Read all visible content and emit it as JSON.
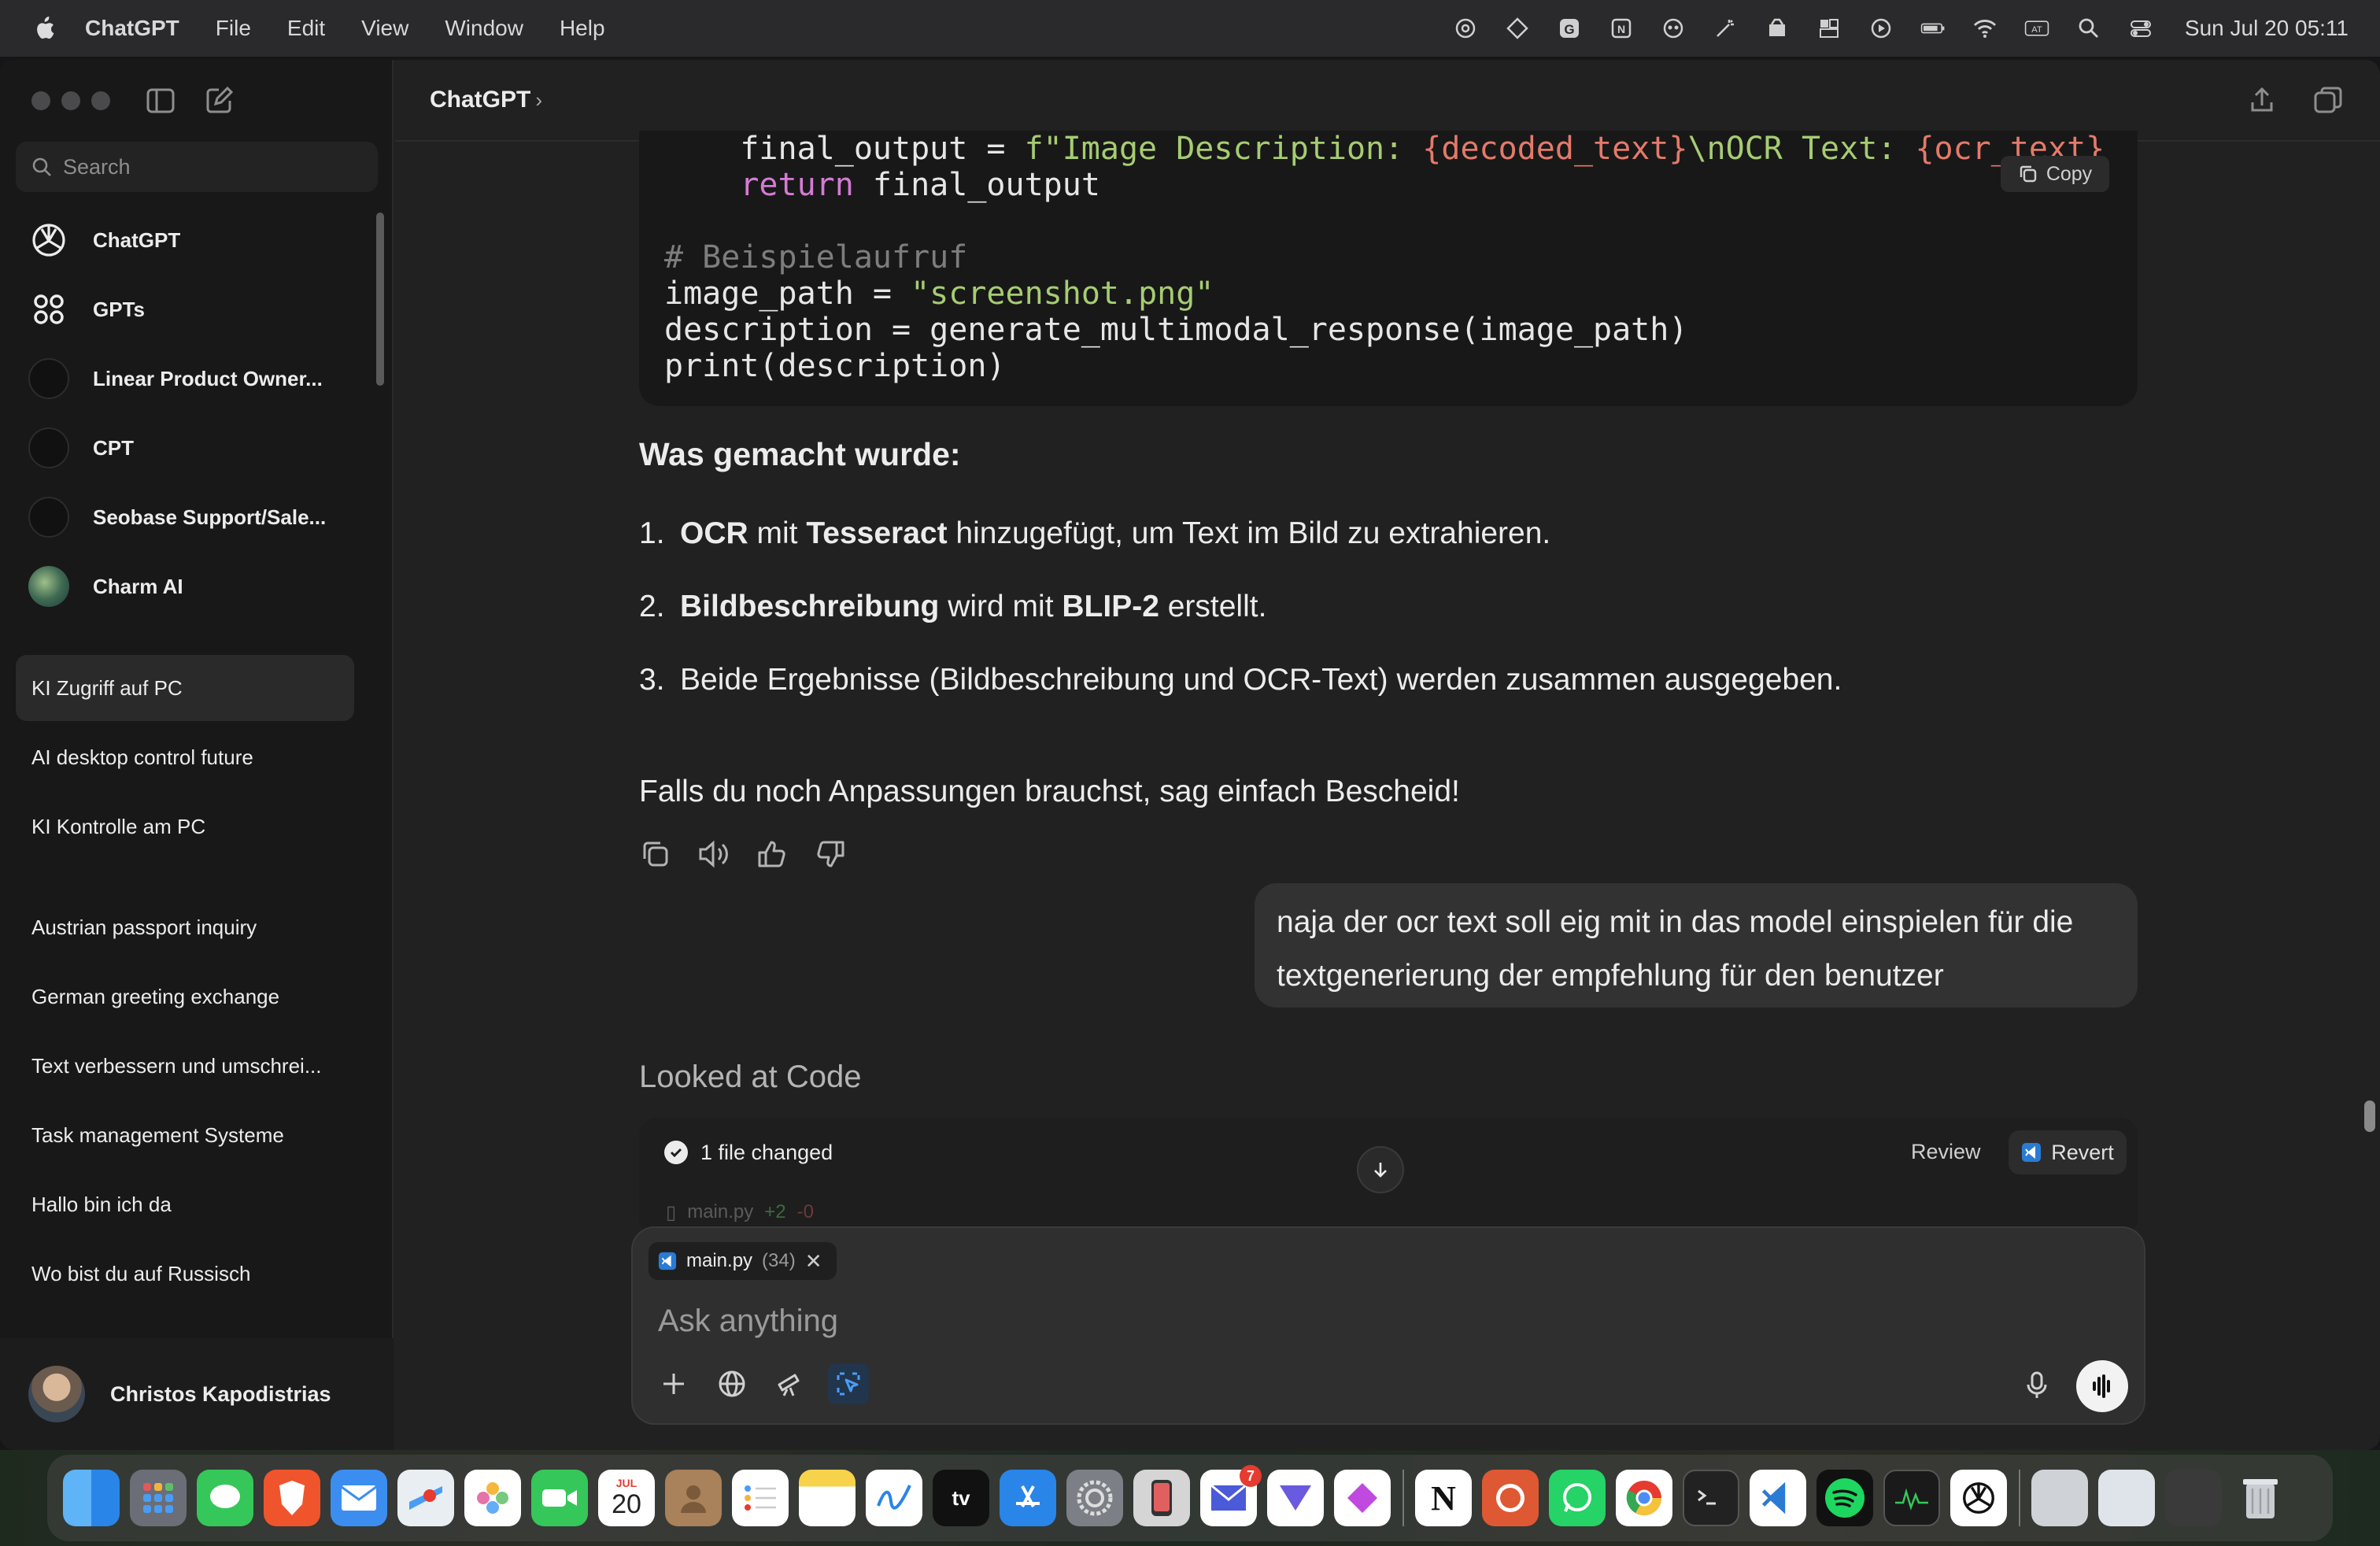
{
  "menubar": {
    "app": "ChatGPT",
    "menus": [
      "File",
      "Edit",
      "View",
      "Window",
      "Help"
    ],
    "clock": "Sun Jul 20  05:11"
  },
  "sidebar": {
    "search_placeholder": "Search",
    "nav": [
      {
        "label": "ChatGPT",
        "icon": "chatgpt-logo-icon"
      },
      {
        "label": "GPTs",
        "icon": "grid-dots-icon"
      },
      {
        "label": "Linear Product Owner...",
        "icon": "gpt-avatar"
      },
      {
        "label": "CPT",
        "icon": "gpt-avatar"
      },
      {
        "label": "Seobase Support/Sale...",
        "icon": "gpt-avatar"
      },
      {
        "label": "Charm AI",
        "icon": "gpt-avatar-image"
      }
    ],
    "chats": [
      "KI Zugriff auf PC",
      "AI desktop control future",
      "KI Kontrolle am PC",
      "Austrian passport inquiry",
      "German greeting exchange",
      "Text verbessern und umschrei...",
      "Task management Systeme",
      "Hallo bin ich da",
      "Wo bist du auf Russisch"
    ],
    "user": "Christos Kapodistrias"
  },
  "header": {
    "title": "ChatGPT",
    "chevron": "›"
  },
  "code": {
    "lines": [
      [
        {
          "t": "    final_output = ",
          "c": "pl"
        },
        {
          "t": "f\"Image Description: ",
          "c": "str"
        },
        {
          "t": "{decoded_text}",
          "c": "var"
        },
        {
          "t": "\\nOCR Text: ",
          "c": "str"
        },
        {
          "t": "{ocr_text}",
          "c": "var"
        }
      ],
      [
        {
          "t": "    ",
          "c": "pl"
        },
        {
          "t": "return",
          "c": "kw"
        },
        {
          "t": " final_output",
          "c": "pl"
        }
      ],
      [
        {
          "t": "",
          "c": "pl"
        }
      ],
      [
        {
          "t": "# Beispielaufruf",
          "c": "cm"
        }
      ],
      [
        {
          "t": "image_path = ",
          "c": "pl"
        },
        {
          "t": "\"screenshot.png\"",
          "c": "str"
        }
      ],
      [
        {
          "t": "description = generate_multimodal_response(image_path)",
          "c": "pl"
        }
      ],
      [
        {
          "t": "print(description)",
          "c": "pl"
        }
      ]
    ],
    "copy_label": "Copy"
  },
  "answer": {
    "heading": "Was gemacht wurde:",
    "items": [
      {
        "num": "1.",
        "parts": [
          {
            "t": "OCR",
            "b": true
          },
          {
            "t": " mit ",
            "b": false
          },
          {
            "t": "Tesseract",
            "b": true
          },
          {
            "t": " hinzugefügt, um Text im Bild zu extrahieren.",
            "b": false
          }
        ]
      },
      {
        "num": "2.",
        "parts": [
          {
            "t": "Bildbeschreibung",
            "b": true
          },
          {
            "t": " wird mit ",
            "b": false
          },
          {
            "t": "BLIP-2",
            "b": true
          },
          {
            "t": " erstellt.",
            "b": false
          }
        ]
      },
      {
        "num": "3.",
        "parts": [
          {
            "t": "Beide Ergebnisse (Bildbeschreibung und OCR-Text) werden zusammen ausgegeben.",
            "b": false
          }
        ]
      }
    ],
    "closing": "Falls du noch Anpassungen brauchst, sag einfach Bescheid!"
  },
  "user_message": "naja der ocr text soll eig mit in das model einspielen für die textgenerierung der empfehlung für den benutzer",
  "looked_at": "Looked at Code",
  "filecard": {
    "summary": "1 file changed",
    "review": "Review",
    "revert": "Revert",
    "file": "main.py",
    "added": "+2",
    "removed": "-0"
  },
  "composer": {
    "attachment_name": "main.py",
    "attachment_count": "(34)",
    "placeholder": "Ask anything"
  },
  "dock": {
    "calendar_month": "JUL",
    "calendar_day": "20",
    "mail_badge": "7",
    "tv_label": "tv",
    "notion_label": "N"
  }
}
